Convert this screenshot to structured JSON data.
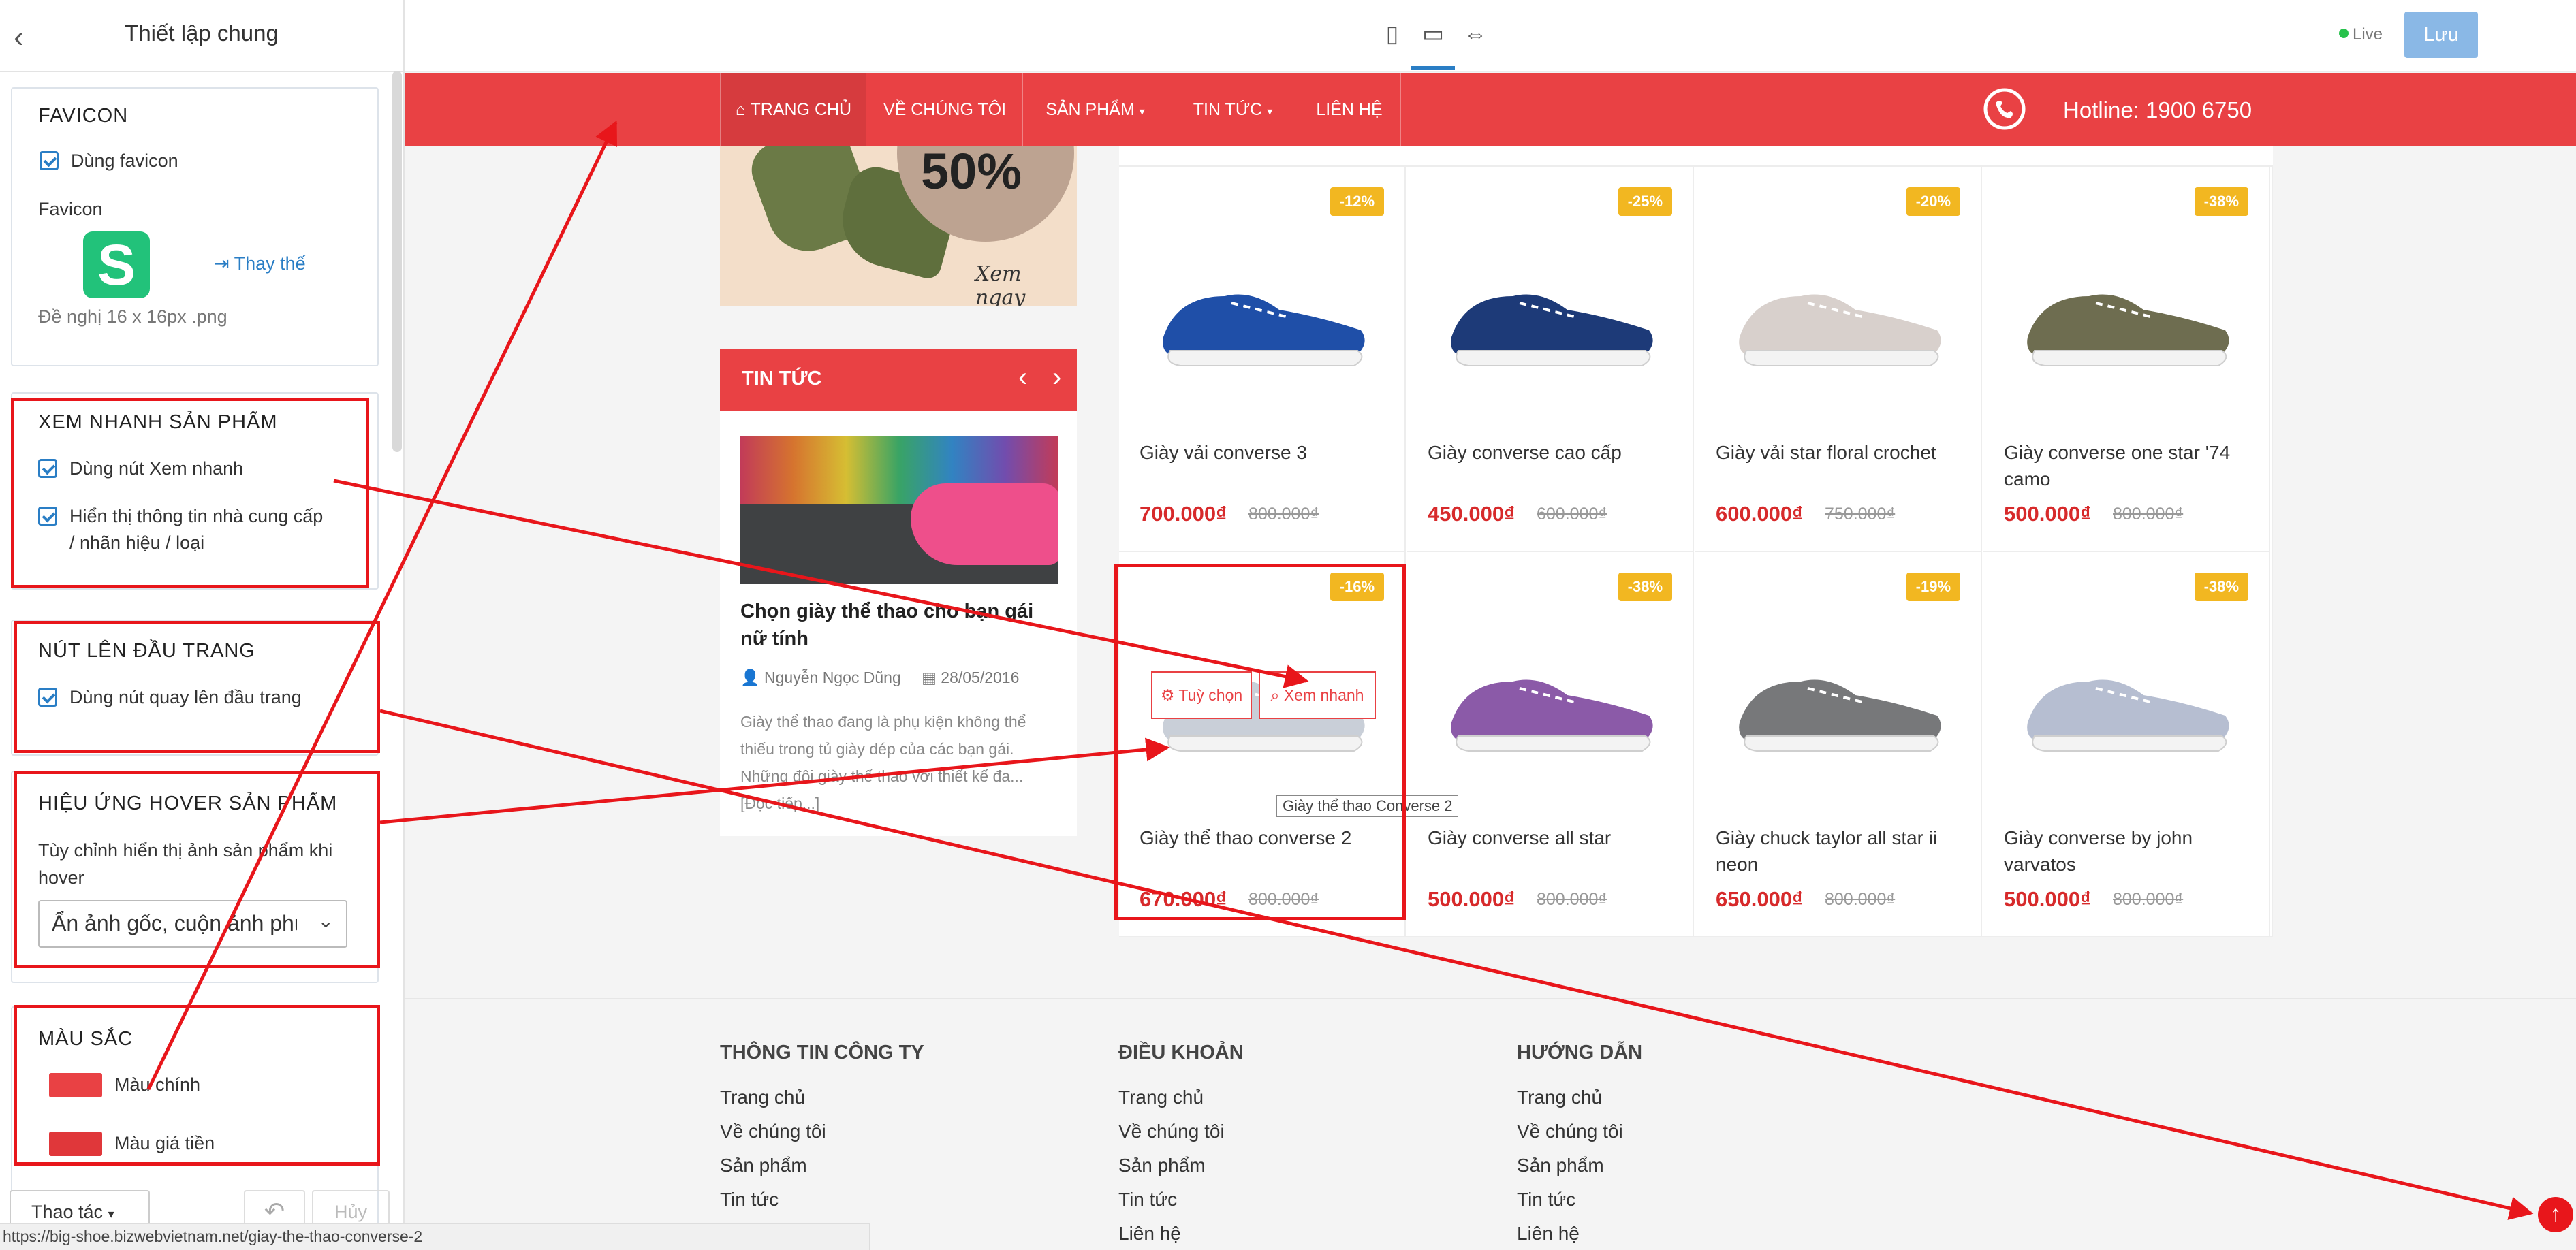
{
  "sidebar": {
    "title": "Thiết lập chung",
    "favicon": {
      "heading": "FAVICON",
      "use_favicon": "Dùng favicon",
      "field_label": "Favicon",
      "replace": "Thay thế",
      "hint": "Đề nghị 16 x 16px .png",
      "logo_letter": "S"
    },
    "quickview": {
      "heading": "XEM NHANH SẢN PHẨM",
      "use_btn": "Dùng nút Xem nhanh",
      "show_vendor_line1": "Hiển thị thông tin nhà cung cấp",
      "show_vendor_line2": "/ nhãn hiệu / loại"
    },
    "backtotop": {
      "heading": "NÚT LÊN ĐẦU TRANG",
      "use_btn": "Dùng nút quay lên đầu trang"
    },
    "hover": {
      "heading": "HIỆU ỨNG HOVER SẢN PHẨM",
      "desc_line1": "Tùy chỉnh hiển thị ảnh sản phẩm khi",
      "desc_line2": "hover",
      "select_value": "Ẩn ảnh gốc, cuộn ảnh phụ"
    },
    "colors": {
      "heading": "MÀU SẮC",
      "main": "Màu chính",
      "price": "Màu giá tiền",
      "main_hex": "#e94144",
      "price_hex": "#e0373a"
    },
    "actions_label": "Thao tác",
    "cancel_label": "Hủy"
  },
  "topbar": {
    "live_label": "Live",
    "save_label": "Lưu"
  },
  "nav": {
    "items": [
      "TRANG CHỦ",
      "VỀ CHÚNG TÔI",
      "SẢN PHẨM",
      "TIN TỨC",
      "LIÊN HỆ"
    ],
    "hotline": "Hotline: 1900 6750"
  },
  "banner": {
    "percent": "50%",
    "cta": "Xem ngay"
  },
  "news": {
    "heading": "TIN TỨC",
    "title_line1": "Chọn giày thể thao cho bạn gái",
    "title_line2": "nữ tính",
    "author": "Nguyễn Ngọc Dũng",
    "date": "28/05/2016",
    "excerpt_line1": "Giày thể thao đang là phụ kiện không thể",
    "excerpt_line2": "thiếu trong tủ giày dép của các bạn gái.",
    "excerpt_line3": "Những đôi giày thể thao với thiết kế đa...",
    "more": "[Đọc tiếp...]"
  },
  "products": [
    {
      "name_line1": "Giày vải converse 3",
      "name_line2": "",
      "price": "700.000₫",
      "old_price": "800.000₫",
      "discount": "-12%",
      "color": "#1f4fa8"
    },
    {
      "name_line1": "Giày converse cao cấp",
      "name_line2": "",
      "price": "450.000₫",
      "old_price": "600.000₫",
      "discount": "-25%",
      "color": "#1d3a78"
    },
    {
      "name_line1": "Giày vải star floral crochet",
      "name_line2": "",
      "price": "600.000₫",
      "old_price": "750.000₫",
      "discount": "-20%",
      "color": "#d8d0cc"
    },
    {
      "name_line1": "Giày converse one star '74",
      "name_line2": "camo",
      "price": "500.000₫",
      "old_price": "800.000₫",
      "discount": "-38%",
      "color": "#6e6d50"
    },
    {
      "name_line1": "Giày thể thao converse 2",
      "name_line2": "",
      "price": "670.000₫",
      "old_price": "800.000₫",
      "discount": "-16%",
      "color": "#c9cfd8"
    },
    {
      "name_line1": "Giày converse all star",
      "name_line2": "",
      "price": "500.000₫",
      "old_price": "800.000₫",
      "discount": "-38%",
      "color": "#8b5aa8"
    },
    {
      "name_line1": "Giày chuck taylor all star ii",
      "name_line2": "neon",
      "price": "650.000₫",
      "old_price": "800.000₫",
      "discount": "-19%",
      "color": "#77787a"
    },
    {
      "name_line1": "Giày converse by john",
      "name_line2": "varvatos",
      "price": "500.000₫",
      "old_price": "800.000₫",
      "discount": "-38%",
      "color": "#b6bed1"
    }
  ],
  "hover_overlay": {
    "options": "Tuỳ chọn",
    "quickview": "Xem nhanh",
    "tooltip": "Giày thể thao Converse 2"
  },
  "footer": {
    "cols": [
      {
        "heading": "THÔNG TIN CÔNG TY",
        "links": [
          "Trang chủ",
          "Về chúng tôi",
          "Sản phẩm",
          "Tin tức"
        ]
      },
      {
        "heading": "ĐIỀU KHOẢN",
        "links": [
          "Trang chủ",
          "Về chúng tôi",
          "Sản phẩm",
          "Tin tức",
          "Liên hệ"
        ]
      },
      {
        "heading": "HƯỚNG DẪN",
        "links": [
          "Trang chủ",
          "Về chúng tôi",
          "Sản phẩm",
          "Tin tức",
          "Liên hệ"
        ]
      }
    ]
  },
  "status_url": "https://big-shoe.bizwebvietnam.net/giay-the-thao-converse-2"
}
